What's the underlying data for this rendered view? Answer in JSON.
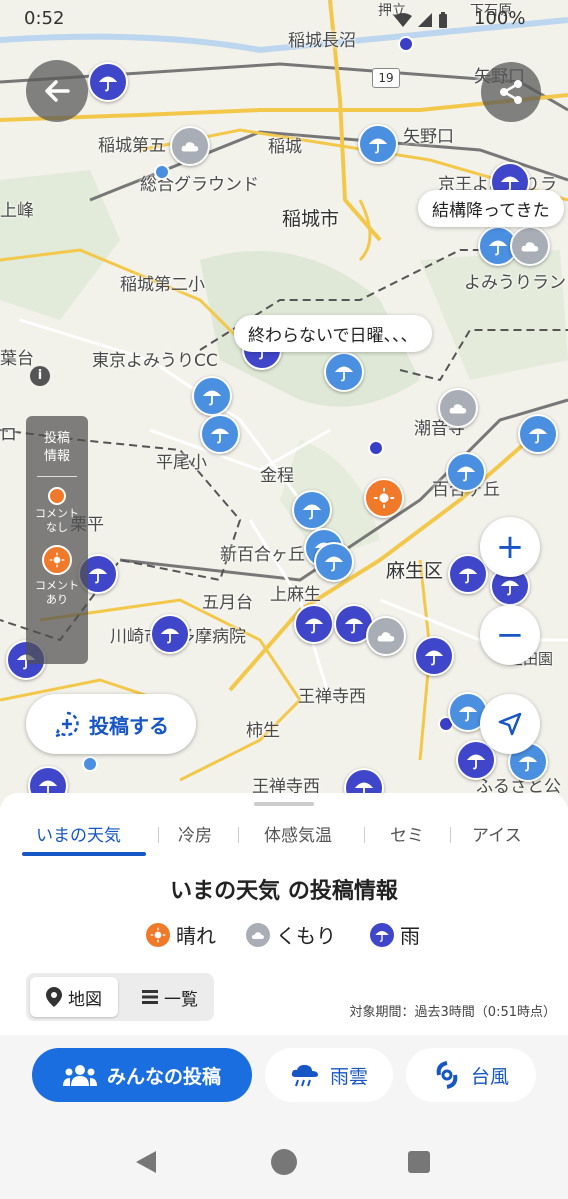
{
  "status_bar": {
    "time": "0:52",
    "battery": "100%"
  },
  "map": {
    "places": [
      {
        "id": "inagi-naganuma",
        "text": "稲城長沼"
      },
      {
        "id": "yanokuchi-st",
        "text": "矢野口"
      },
      {
        "id": "inagi-daigo",
        "text": "稲城第五"
      },
      {
        "id": "inagi-st",
        "text": "稲城"
      },
      {
        "id": "yanokuchi",
        "text": "矢野口"
      },
      {
        "id": "sogo-ground",
        "text": "総合グラウンド"
      },
      {
        "id": "keio-yomiuri",
        "text": "京王よみうりラ"
      },
      {
        "id": "inagi-city",
        "text": "稲城市"
      },
      {
        "id": "inagi-daini",
        "text": "稲城第二小"
      },
      {
        "id": "yomiuri-land",
        "text": "よみうりラン"
      },
      {
        "id": "tokyo-yomiuri-cc",
        "text": "東京よみうりCC"
      },
      {
        "id": "hirao",
        "text": "平尾小"
      },
      {
        "id": "shiomizu",
        "text": "潮音寺"
      },
      {
        "id": "konpira",
        "text": "金程"
      },
      {
        "id": "yurigaoka",
        "text": "百合ヶ丘"
      },
      {
        "id": "kuribira",
        "text": "栗平"
      },
      {
        "id": "shinyurigaoka",
        "text": "新百合ヶ丘"
      },
      {
        "id": "asao-ku",
        "text": "麻生区"
      },
      {
        "id": "kamiasao",
        "text": "上麻生"
      },
      {
        "id": "satsukidai",
        "text": "五月台"
      },
      {
        "id": "kawasaki-hosp",
        "text": "川崎市立多摩病院"
      },
      {
        "id": "ozenji-nishi",
        "text": "王禅寺西"
      },
      {
        "id": "kakio",
        "text": "柿生"
      },
      {
        "id": "ozenji-nishi2",
        "text": "王禅寺西"
      },
      {
        "id": "furusato",
        "text": "ふるさと公"
      },
      {
        "id": "route19",
        "text": "19"
      },
      {
        "id": "minamitama",
        "text": "押立"
      },
      {
        "id": "shimoishihara",
        "text": "下石原"
      },
      {
        "id": "kaminagano",
        "text": "上峰"
      },
      {
        "id": "hazama",
        "text": "葉台"
      },
      {
        "id": "ro",
        "text": "ロ"
      },
      {
        "id": "ikuta",
        "text": "生田園"
      }
    ],
    "bubbles": [
      {
        "id": "bubble-1",
        "text": "結構降ってきた"
      },
      {
        "id": "bubble-2",
        "text": "終わらないで日曜、、、"
      }
    ],
    "legend_panel": {
      "title": "投稿\n情報",
      "no_comment": "コメント\nなし",
      "with_comment": "コメント\nあり"
    },
    "post_button": "投稿する",
    "zoom_in": "+",
    "zoom_out": "−"
  },
  "sheet": {
    "tabs": [
      "いまの天気",
      "冷房",
      "体感気温",
      "セミ",
      "アイス"
    ],
    "active_tab": 0,
    "title": "いまの天気 の投稿情報",
    "legend": [
      {
        "label": "晴れ",
        "color": "#f07a2a",
        "icon": "sun-icon"
      },
      {
        "label": "くもり",
        "color": "#a9adb5",
        "icon": "cloud-icon"
      },
      {
        "label": "雨",
        "color": "#3f46c9",
        "icon": "umbrella-icon"
      }
    ],
    "view_toggle": {
      "map": "地図",
      "list": "一覧"
    },
    "period": "対象期間：過去3時間（0:51時点）"
  },
  "bottom_bar": {
    "everyone": "みんなの投稿",
    "rain_cloud": "雨雲",
    "typhoon": "台風",
    "colors": {
      "primary": "#1a6ee0",
      "rain_icon": "#1656c5"
    }
  }
}
